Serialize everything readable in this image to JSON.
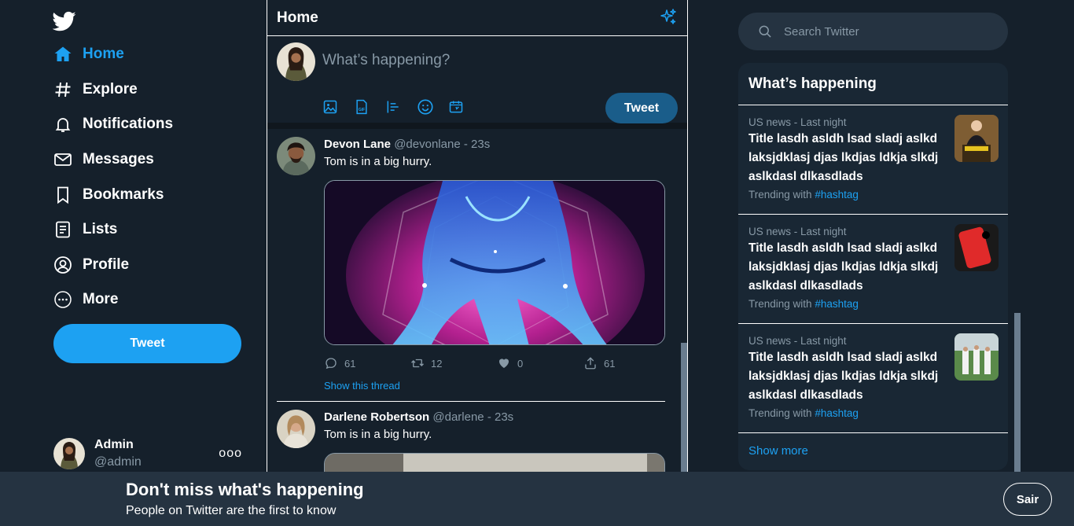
{
  "sidebar": {
    "nav": [
      {
        "label": "Home",
        "icon": "home-icon",
        "active": true
      },
      {
        "label": "Explore",
        "icon": "hashtag-icon",
        "active": false
      },
      {
        "label": "Notifications",
        "icon": "bell-icon",
        "active": false
      },
      {
        "label": "Messages",
        "icon": "envelope-icon",
        "active": false
      },
      {
        "label": "Bookmarks",
        "icon": "bookmark-icon",
        "active": false
      },
      {
        "label": "Lists",
        "icon": "list-icon",
        "active": false
      },
      {
        "label": "Profile",
        "icon": "user-icon",
        "active": false
      },
      {
        "label": "More",
        "icon": "more-circle-icon",
        "active": false
      }
    ],
    "tweet_label": "Tweet",
    "account": {
      "name": "Admin",
      "handle": "@admin",
      "menu": "ooo"
    }
  },
  "main": {
    "title": "Home",
    "composer": {
      "placeholder": "What’s happening?",
      "tweet_label": "Tweet"
    },
    "tweets": [
      {
        "name": "Devon Lane",
        "handle": "@devonlane",
        "time": "23s",
        "text": "Tom is in a big hurry.",
        "replies": "61",
        "retweets": "12",
        "likes": "0",
        "shares": "61",
        "thread_label": "Show this thread"
      },
      {
        "name": "Darlene Robertson",
        "handle": "@darlene",
        "time": "23s",
        "text": "Tom is in a big hurry."
      }
    ]
  },
  "right": {
    "search_placeholder": "Search Twitter",
    "trends_title": "What’s happening",
    "trends": [
      {
        "category": "US news - Last night",
        "text": "Title lasdh asldh lsad sladj aslkd laksjdklasj djas lkdjas ldkja slkdj aslkdasl dlkasdlads",
        "with_label": "Trending with",
        "hashtag": "#hashtag"
      },
      {
        "category": "US news - Last night",
        "text": "Title lasdh asldh lsad sladj aslkd laksjdklasj djas lkdjas ldkja slkdj aslkdasl dlkasdlads",
        "with_label": "Trending with",
        "hashtag": "#hashtag"
      },
      {
        "category": "US news - Last night",
        "text": "Title lasdh asldh lsad sladj aslkd laksjdklasj djas lkdjas ldkja slkdj aslkdasl dlkasdlads",
        "with_label": "Trending with",
        "hashtag": "#hashtag"
      }
    ],
    "show_more": "Show more"
  },
  "bottom_bar": {
    "title": "Don't miss what's happening",
    "subtitle": "People on Twitter are the first to know",
    "button": "Sair"
  },
  "colors": {
    "background": "#15202b",
    "accent": "#1da1f2",
    "muted_text": "#8899a6",
    "card": "#192734",
    "bottom_bar": "#253341"
  }
}
